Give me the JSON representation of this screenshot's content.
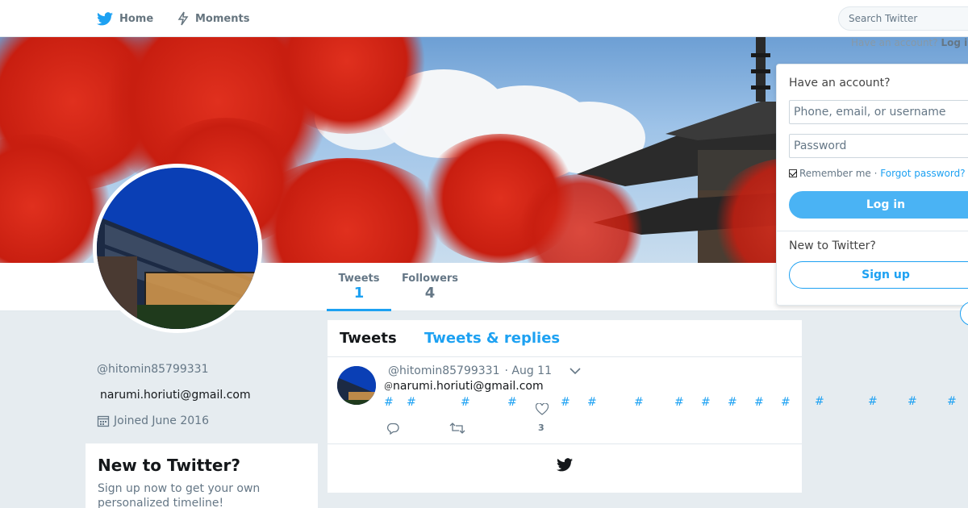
{
  "nav": {
    "home_label": "Home",
    "moments_label": "Moments",
    "search_placeholder": "Search Twitter",
    "have_account_prompt": "Have an account?",
    "login_link": "Log in"
  },
  "profile": {
    "handle": "@hitomin85799331",
    "email": "narumi.horiuti@gmail.com",
    "joined": "Joined June 2016"
  },
  "stats": [
    {
      "label": "Tweets",
      "value": "1"
    },
    {
      "label": "Followers",
      "value": "4"
    }
  ],
  "signup_card": {
    "title": "New to Twitter?",
    "text": "Sign up now to get your own personalized timeline!"
  },
  "timeline": {
    "tabs": [
      "Tweets",
      "Tweets & replies"
    ],
    "tweet": {
      "handle": "@hitomin85799331",
      "date": "· Aug 11",
      "at_symbol": "＠",
      "text": "narumi.horiuti@gmail.com",
      "hashtags": [
        "#",
        "#",
        "#",
        "#",
        "#",
        "#",
        "#",
        "#",
        "#",
        "#",
        "#",
        "#",
        "#",
        "#",
        "#",
        "#"
      ],
      "like_count": "3"
    }
  },
  "login_box": {
    "title": "Have an account?",
    "username_placeholder": "Phone, email, or username",
    "password_placeholder": "Password",
    "remember_label": "Remember me",
    "separator": "·",
    "forgot_label": "Forgot password?",
    "login_button": "Log in",
    "new_prompt": "New to Twitter?",
    "signup_button": "Sign up"
  },
  "colors": {
    "accent": "#1da1f2",
    "background": "#e6ecf0",
    "login_button": "#4ab3f4"
  },
  "icons": [
    "twitter-bird-icon",
    "lightning-icon",
    "calendar-icon",
    "reply-icon",
    "retweet-icon",
    "heart-icon",
    "caret-down-icon"
  ]
}
